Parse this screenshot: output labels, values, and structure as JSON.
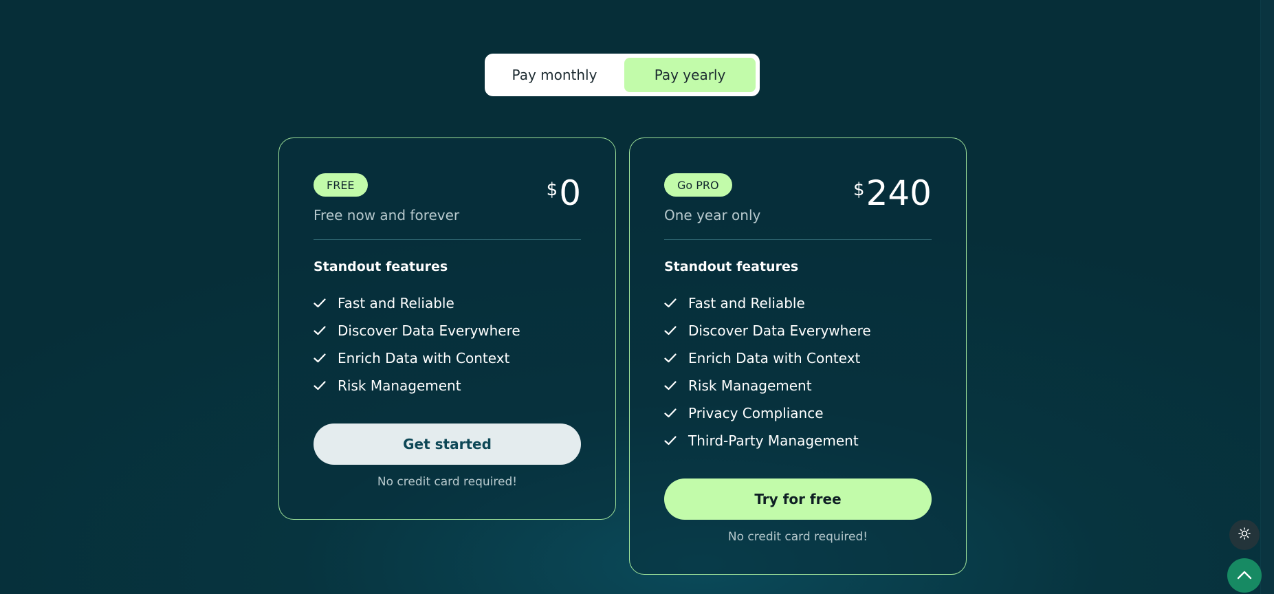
{
  "billing_toggle": {
    "monthly_label": "Pay monthly",
    "yearly_label": "Pay yearly",
    "selected": "yearly"
  },
  "plans": [
    {
      "badge": "FREE",
      "subtitle": "Free now and forever",
      "currency": "$",
      "amount": "0",
      "features_title": "Standout features",
      "features": [
        "Fast and Reliable",
        "Discover Data Everywhere",
        "Enrich Data with Context",
        "Risk Management"
      ],
      "cta_label": "Get started",
      "cta_note": "No credit card required!"
    },
    {
      "badge": "Go PRO",
      "subtitle": "One year only",
      "currency": "$",
      "amount": "240",
      "features_title": "Standout features",
      "features": [
        "Fast and Reliable",
        "Discover Data Everywhere",
        "Enrich Data with Context",
        "Risk Management",
        "Privacy Compliance",
        "Third-Party Management"
      ],
      "cta_label": "Try for free",
      "cta_note": "No credit card required!"
    }
  ],
  "floating_buttons": {
    "theme_icon": "sun-icon",
    "scroll_top_icon": "chevron-up-icon"
  },
  "colors": {
    "accent": "#c2fbaa",
    "background": "#062e38",
    "card_border": "#9fe39a",
    "scroll_top_bg": "#178a63"
  }
}
